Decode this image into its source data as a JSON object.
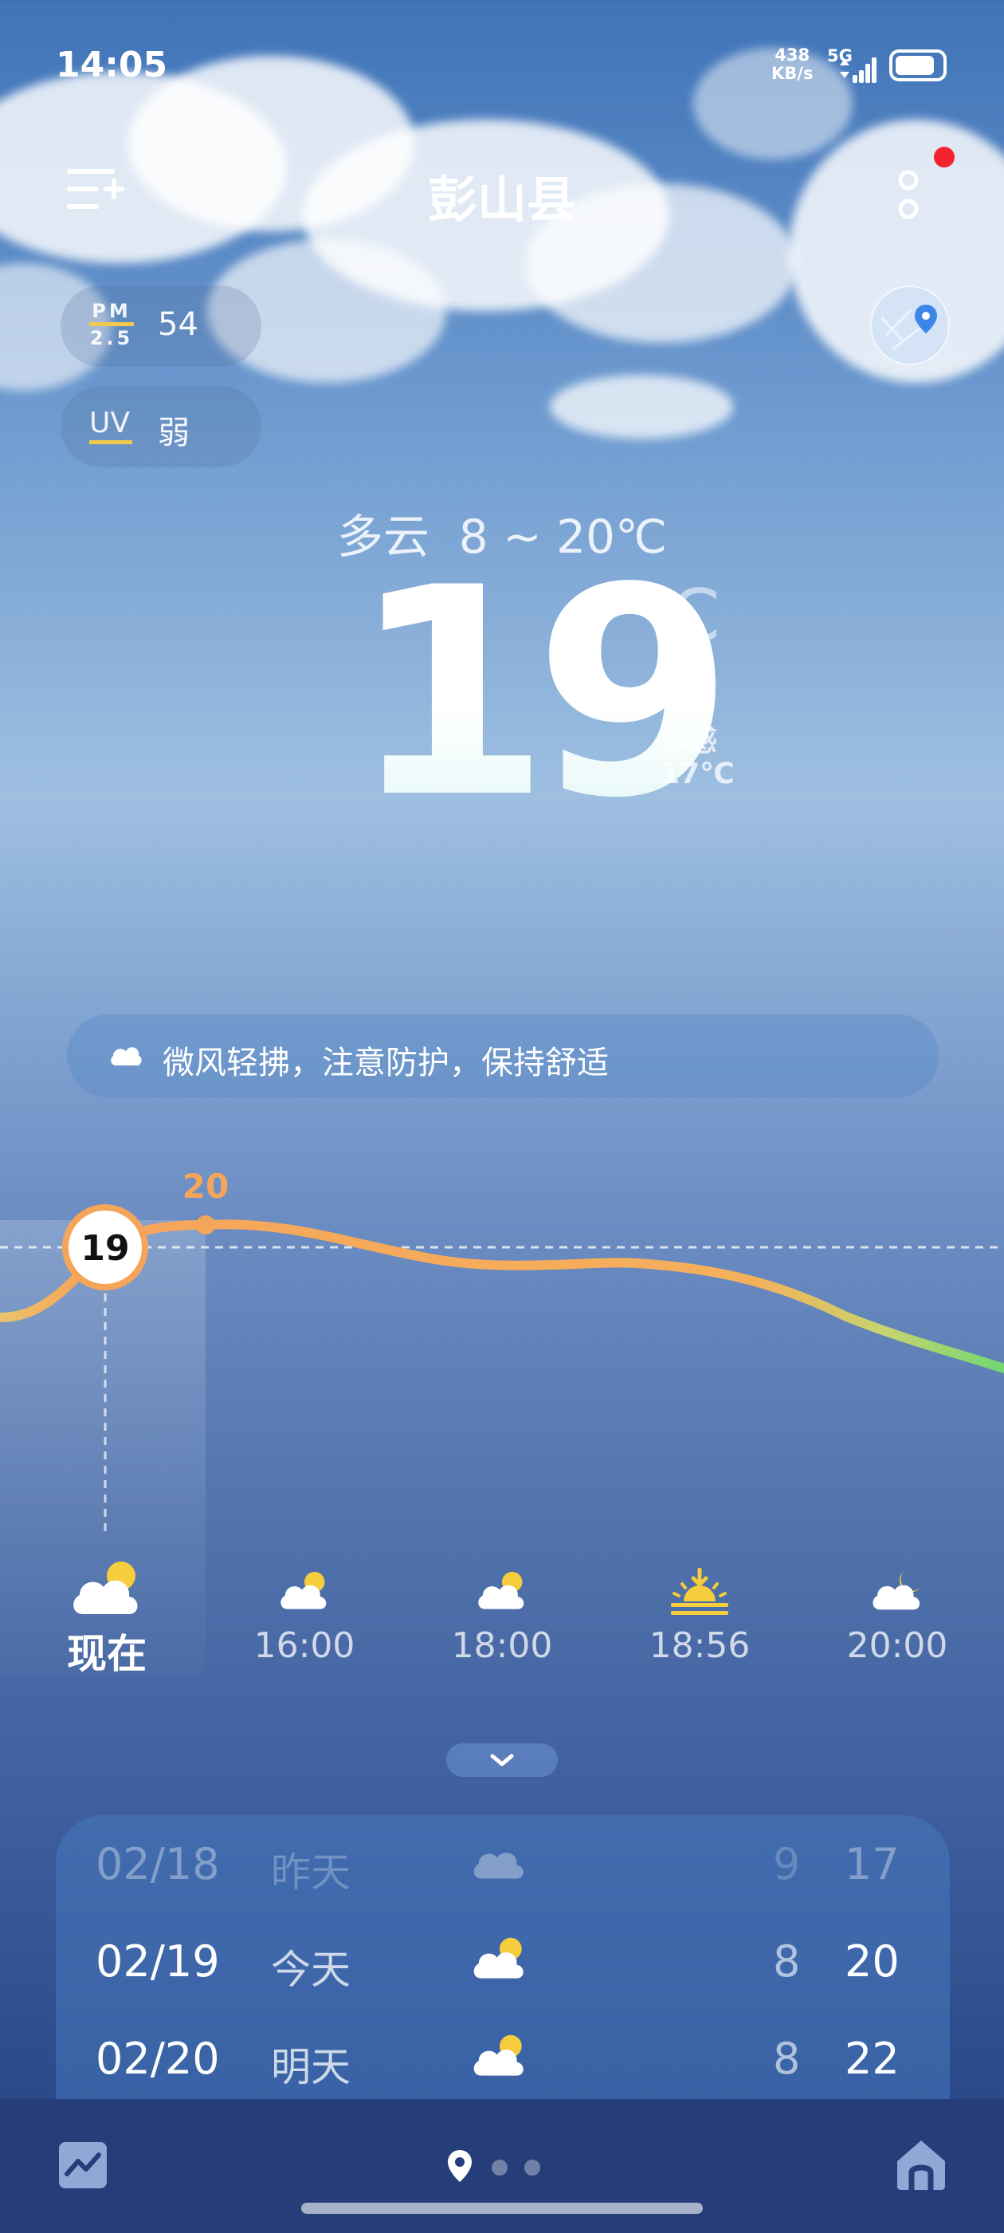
{
  "status_bar": {
    "time": "14:05",
    "net_speed_value": "438",
    "net_speed_unit": "KB/s",
    "network": "5G",
    "battery_level": 0.85
  },
  "header": {
    "city": "彭山县",
    "menu_icon": "add-city-list-icon",
    "more_icon": "more-vertical-icon",
    "has_notification_dot": true
  },
  "air": {
    "pm_label_top": "PM",
    "pm_label_bottom": "2.5",
    "pm_value": "54",
    "uv_label": "UV",
    "uv_value": "弱"
  },
  "map_button": {
    "icon": "map-pin-icon"
  },
  "current": {
    "condition": "多云",
    "range": "8 ~ 20℃",
    "temp": "19",
    "unit": "℃",
    "feels_label": "体感",
    "feels_value": "17℃"
  },
  "tip": {
    "icon": "cloud-icon",
    "text": "微风轻拂，注意防护，保持舒适"
  },
  "hourly_chart": {
    "current_value": "19",
    "peak_value": "20"
  },
  "hourly": [
    {
      "label": "现在",
      "icon": "partly-cloudy-icon"
    },
    {
      "label": "16:00",
      "icon": "partly-cloudy-icon"
    },
    {
      "label": "18:00",
      "icon": "partly-cloudy-icon"
    },
    {
      "label": "18:56",
      "icon": "sunset-icon"
    },
    {
      "label": "20:00",
      "icon": "cloudy-night-icon"
    }
  ],
  "daily": [
    {
      "date": "02/18",
      "name": "昨天",
      "icon": "cloud-icon",
      "low": "9",
      "high": "17"
    },
    {
      "date": "02/19",
      "name": "今天",
      "icon": "partly-cloudy-icon",
      "low": "8",
      "high": "20"
    },
    {
      "date": "02/20",
      "name": "明天",
      "icon": "partly-cloudy-icon",
      "low": "8",
      "high": "22"
    }
  ],
  "bottom_bar": {
    "trend_icon": "trend-chart-icon",
    "location_icon": "location-pin-icon",
    "home_icon": "home-icon",
    "page_count": 3,
    "active_page": 1
  },
  "colors": {
    "accent_orange": "#f5a55a",
    "curve_green": "#72d672",
    "sun_yellow": "#f5cd3d",
    "notification_red": "#f4212e"
  }
}
